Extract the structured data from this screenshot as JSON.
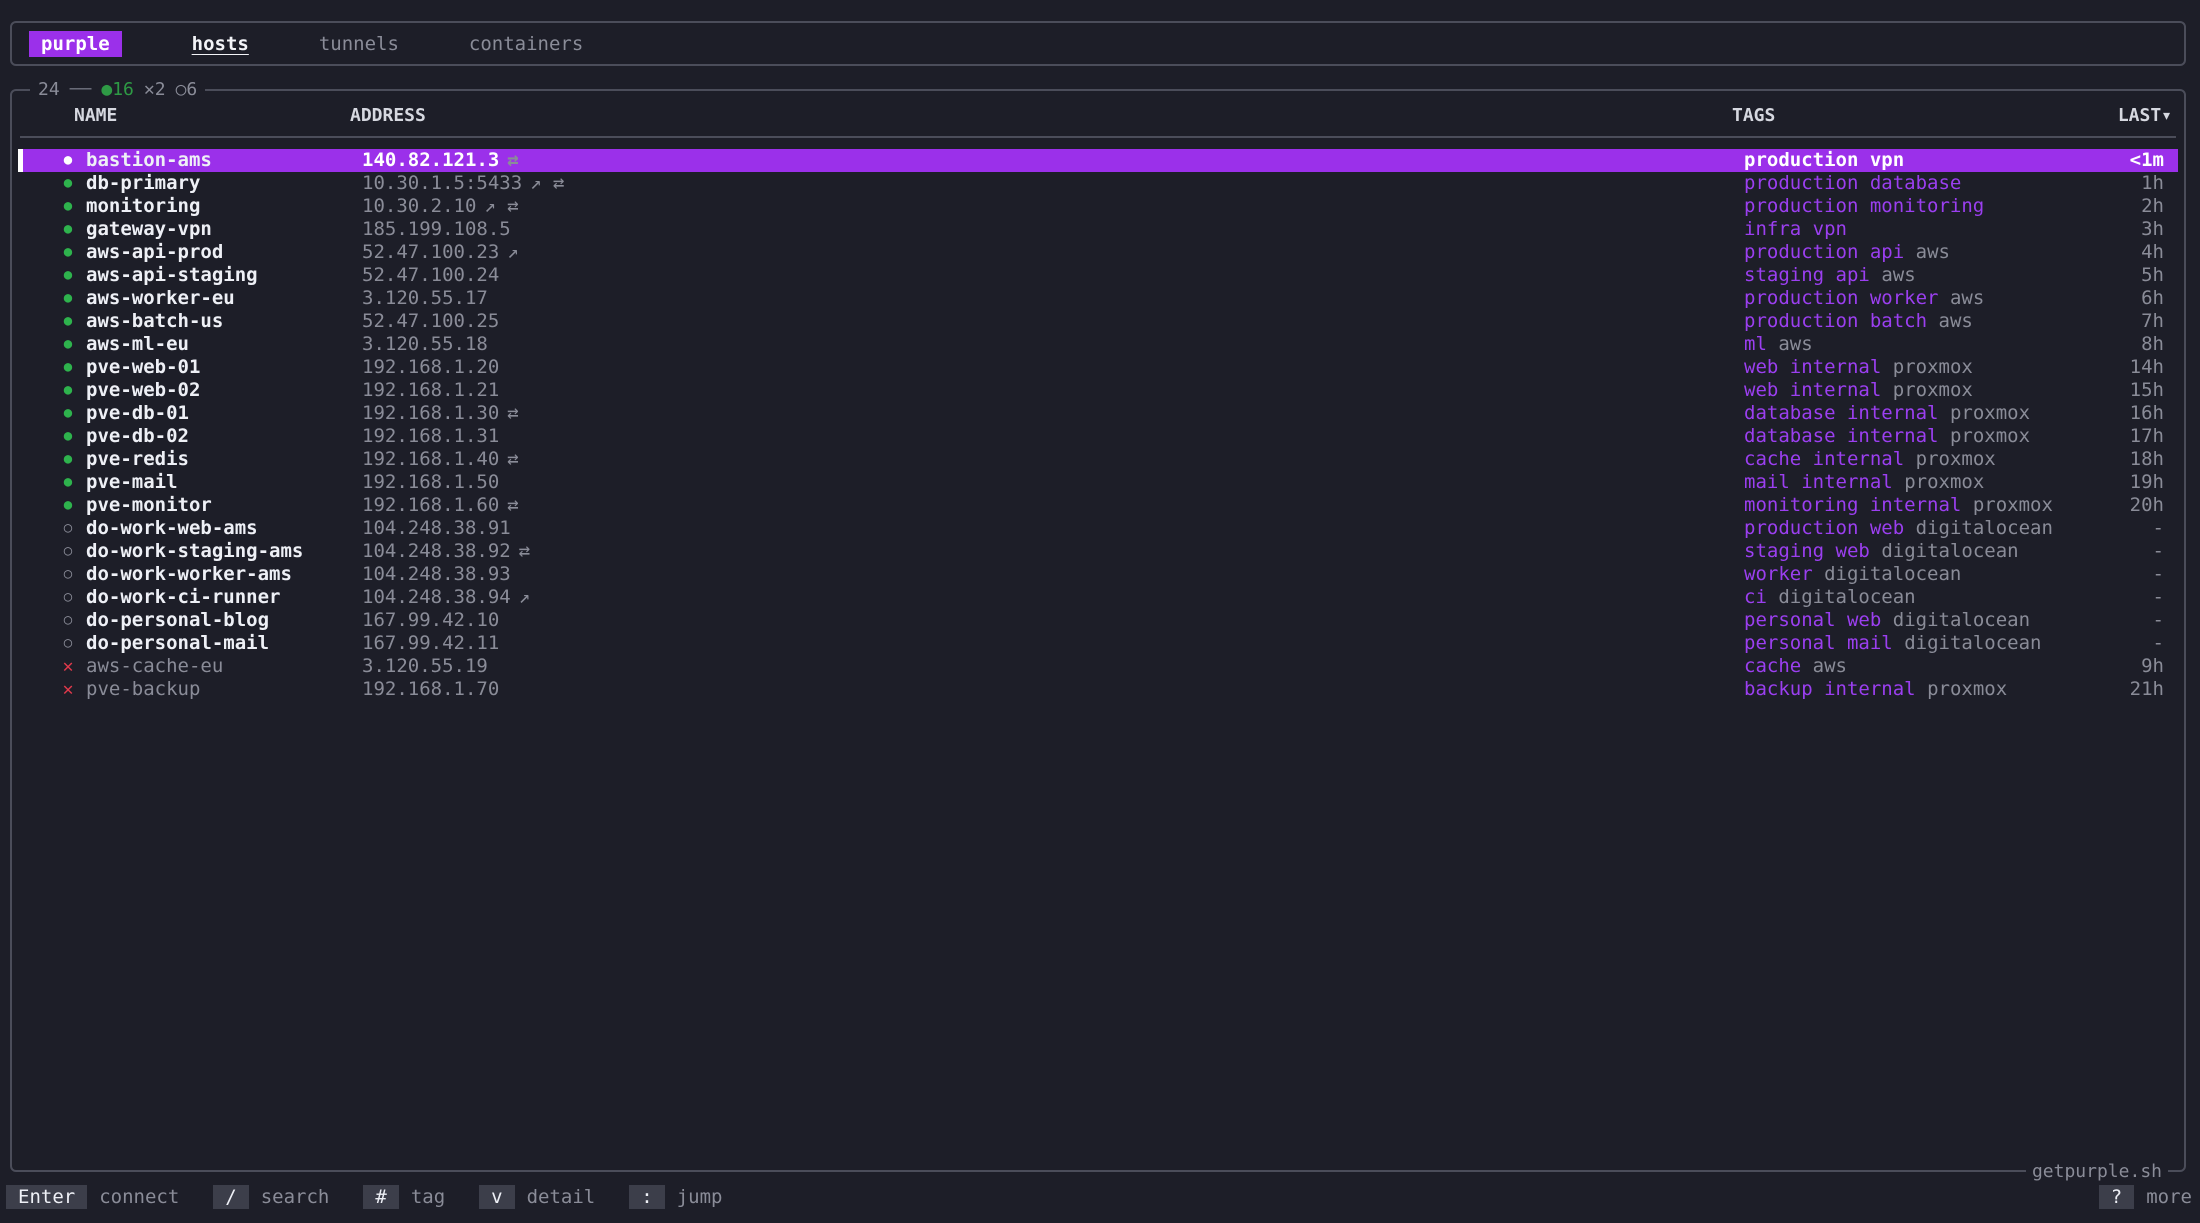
{
  "app": {
    "brand": "purple"
  },
  "tabs": [
    {
      "label": "hosts",
      "active": true
    },
    {
      "label": "tunnels",
      "active": false
    },
    {
      "label": "containers",
      "active": false
    }
  ],
  "summary": {
    "total": "24",
    "online": "●16",
    "failed": "✕2",
    "unknown": "○6"
  },
  "columns": {
    "name": "NAME",
    "address": "ADDRESS",
    "tags": "TAGS",
    "last": "LAST▾"
  },
  "hosts": [
    {
      "status": "online",
      "name": "bastion-ams",
      "address": "140.82.121.3",
      "icons": "⇄",
      "tags": [
        "production",
        "vpn"
      ],
      "provider": "",
      "last": "<1m",
      "selected": true
    },
    {
      "status": "online",
      "name": "db-primary",
      "address": "10.30.1.5:5433",
      "icons": "↗ ⇄",
      "tags": [
        "production",
        "database"
      ],
      "provider": "",
      "last": "1h"
    },
    {
      "status": "online",
      "name": "monitoring",
      "address": "10.30.2.10",
      "icons": "↗ ⇄",
      "tags": [
        "production",
        "monitoring"
      ],
      "provider": "",
      "last": "2h"
    },
    {
      "status": "online",
      "name": "gateway-vpn",
      "address": "185.199.108.5",
      "icons": "",
      "tags": [
        "infra",
        "vpn"
      ],
      "provider": "",
      "last": "3h"
    },
    {
      "status": "online",
      "name": "aws-api-prod",
      "address": "52.47.100.23",
      "icons": "↗",
      "tags": [
        "production",
        "api"
      ],
      "provider": "aws",
      "last": "4h"
    },
    {
      "status": "online",
      "name": "aws-api-staging",
      "address": "52.47.100.24",
      "icons": "",
      "tags": [
        "staging",
        "api"
      ],
      "provider": "aws",
      "last": "5h"
    },
    {
      "status": "online",
      "name": "aws-worker-eu",
      "address": "3.120.55.17",
      "icons": "",
      "tags": [
        "production",
        "worker"
      ],
      "provider": "aws",
      "last": "6h"
    },
    {
      "status": "online",
      "name": "aws-batch-us",
      "address": "52.47.100.25",
      "icons": "",
      "tags": [
        "production",
        "batch"
      ],
      "provider": "aws",
      "last": "7h"
    },
    {
      "status": "online",
      "name": "aws-ml-eu",
      "address": "3.120.55.18",
      "icons": "",
      "tags": [
        "ml"
      ],
      "provider": "aws",
      "last": "8h"
    },
    {
      "status": "online",
      "name": "pve-web-01",
      "address": "192.168.1.20",
      "icons": "",
      "tags": [
        "web",
        "internal"
      ],
      "provider": "proxmox",
      "last": "14h"
    },
    {
      "status": "online",
      "name": "pve-web-02",
      "address": "192.168.1.21",
      "icons": "",
      "tags": [
        "web",
        "internal"
      ],
      "provider": "proxmox",
      "last": "15h"
    },
    {
      "status": "online",
      "name": "pve-db-01",
      "address": "192.168.1.30",
      "icons": "⇄",
      "tags": [
        "database",
        "internal"
      ],
      "provider": "proxmox",
      "last": "16h"
    },
    {
      "status": "online",
      "name": "pve-db-02",
      "address": "192.168.1.31",
      "icons": "",
      "tags": [
        "database",
        "internal"
      ],
      "provider": "proxmox",
      "last": "17h"
    },
    {
      "status": "online",
      "name": "pve-redis",
      "address": "192.168.1.40",
      "icons": "⇄",
      "tags": [
        "cache",
        "internal"
      ],
      "provider": "proxmox",
      "last": "18h"
    },
    {
      "status": "online",
      "name": "pve-mail",
      "address": "192.168.1.50",
      "icons": "",
      "tags": [
        "mail",
        "internal"
      ],
      "provider": "proxmox",
      "last": "19h"
    },
    {
      "status": "online",
      "name": "pve-monitor",
      "address": "192.168.1.60",
      "icons": "⇄",
      "tags": [
        "monitoring",
        "internal"
      ],
      "provider": "proxmox",
      "last": "20h"
    },
    {
      "status": "unknown",
      "name": "do-work-web-ams",
      "address": "104.248.38.91",
      "icons": "",
      "tags": [
        "production",
        "web"
      ],
      "provider": "digitalocean",
      "last": "-"
    },
    {
      "status": "unknown",
      "name": "do-work-staging-ams",
      "address": "104.248.38.92",
      "icons": "⇄",
      "tags": [
        "staging",
        "web"
      ],
      "provider": "digitalocean",
      "last": "-"
    },
    {
      "status": "unknown",
      "name": "do-work-worker-ams",
      "address": "104.248.38.93",
      "icons": "",
      "tags": [
        "worker"
      ],
      "provider": "digitalocean",
      "last": "-"
    },
    {
      "status": "unknown",
      "name": "do-work-ci-runner",
      "address": "104.248.38.94",
      "icons": "↗",
      "tags": [
        "ci"
      ],
      "provider": "digitalocean",
      "last": "-"
    },
    {
      "status": "unknown",
      "name": "do-personal-blog",
      "address": "167.99.42.10",
      "icons": "",
      "tags": [
        "personal",
        "web"
      ],
      "provider": "digitalocean",
      "last": "-"
    },
    {
      "status": "unknown",
      "name": "do-personal-mail",
      "address": "167.99.42.11",
      "icons": "",
      "tags": [
        "personal",
        "mail"
      ],
      "provider": "digitalocean",
      "last": "-"
    },
    {
      "status": "failed",
      "name": "aws-cache-eu",
      "address": "3.120.55.19",
      "icons": "",
      "tags": [
        "cache"
      ],
      "provider": "aws",
      "last": "9h"
    },
    {
      "status": "failed",
      "name": "pve-backup",
      "address": "192.168.1.70",
      "icons": "",
      "tags": [
        "backup",
        "internal"
      ],
      "provider": "proxmox",
      "last": "21h"
    }
  ],
  "site": "getpurple.sh",
  "footer": {
    "shortcuts": [
      {
        "key": "Enter",
        "action": "connect"
      },
      {
        "key": "/",
        "action": "search"
      },
      {
        "key": "#",
        "action": "tag"
      },
      {
        "key": "v",
        "action": "detail"
      },
      {
        "key": ":",
        "action": "jump"
      }
    ],
    "more": {
      "key": "?",
      "action": "more"
    }
  },
  "colors": {
    "accent": "#9b30ea",
    "online": "#2eb34d",
    "failed": "#e0394b",
    "background": "#1d1e28"
  },
  "status_icons": {
    "online": "●",
    "unknown": "○",
    "failed": "✕"
  }
}
